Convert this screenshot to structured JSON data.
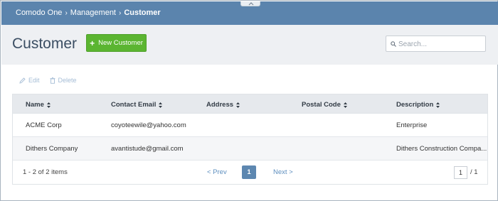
{
  "breadcrumb": {
    "items": [
      "Comodo One",
      "Management"
    ],
    "current": "Customer",
    "separator": "›"
  },
  "header": {
    "title": "Customer",
    "new_button_label": "New Customer",
    "search_placeholder": "Search..."
  },
  "toolbar": {
    "edit_label": "Edit",
    "delete_label": "Delete"
  },
  "table": {
    "columns": [
      "Name",
      "Contact Email",
      "Address",
      "Postal Code",
      "Description"
    ],
    "rows": [
      {
        "name": "ACME Corp",
        "email": "coyoteewile@yahoo.com",
        "address": "",
        "postal": "",
        "description": "Enterprise"
      },
      {
        "name": "Dithers Company",
        "email": "avantistude@gmail.com",
        "address": "",
        "postal": "",
        "description": "Dithers Construction Compa..."
      }
    ]
  },
  "pagination": {
    "summary": "1 - 2 of 2 items",
    "prev_label": "< Prev",
    "current_page": "1",
    "next_label": "Next >",
    "page_input_value": "1",
    "total_pages": "/ 1"
  },
  "colors": {
    "topbar": "#5b84ad",
    "accent_green": "#5bb531",
    "link_blue": "#5e8fbf"
  }
}
